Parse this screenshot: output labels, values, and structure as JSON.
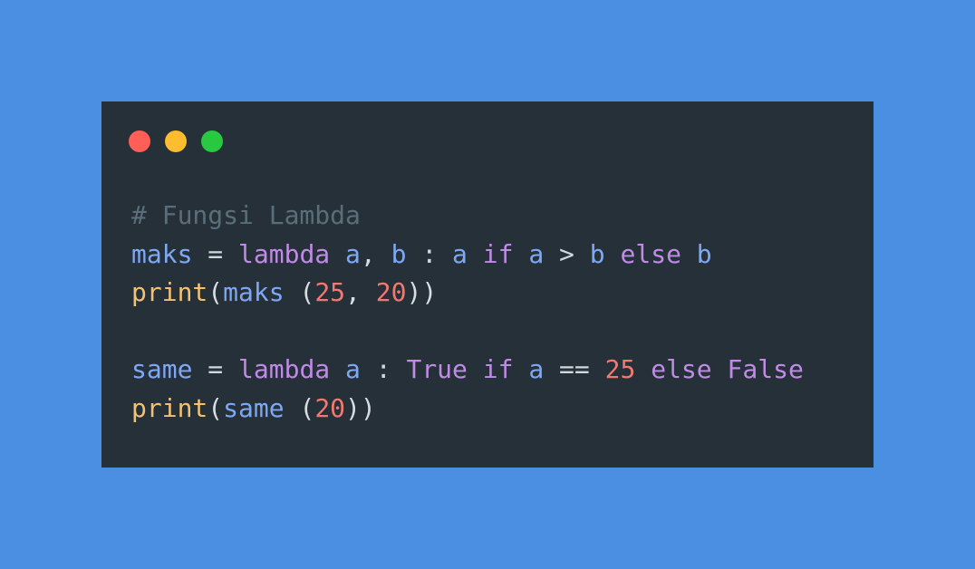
{
  "window": {
    "buttons": [
      {
        "name": "close-dot",
        "color": "#ff5f57"
      },
      {
        "name": "minimize-dot",
        "color": "#febc2e"
      },
      {
        "name": "maximize-dot",
        "color": "#28c840"
      }
    ]
  },
  "colors": {
    "background": "#4a8fe1",
    "editor": "#263038",
    "comment": "#5a6e7a",
    "variable": "#7fa8f4",
    "keyword": "#c08be6",
    "number": "#f07a70",
    "function": "#f2c172"
  },
  "code": {
    "lines": [
      {
        "tokens": [
          {
            "text": "# Fungsi Lambda",
            "type": "comment"
          }
        ]
      },
      {
        "tokens": [
          {
            "text": "maks",
            "type": "var"
          },
          {
            "text": " = ",
            "type": "op"
          },
          {
            "text": "lambda",
            "type": "kw"
          },
          {
            "text": " ",
            "type": "op"
          },
          {
            "text": "a",
            "type": "var"
          },
          {
            "text": ", ",
            "type": "punc"
          },
          {
            "text": "b",
            "type": "var"
          },
          {
            "text": " : ",
            "type": "op"
          },
          {
            "text": "a",
            "type": "var"
          },
          {
            "text": " ",
            "type": "op"
          },
          {
            "text": "if",
            "type": "kw"
          },
          {
            "text": " ",
            "type": "op"
          },
          {
            "text": "a",
            "type": "var"
          },
          {
            "text": " > ",
            "type": "op"
          },
          {
            "text": "b",
            "type": "var"
          },
          {
            "text": " ",
            "type": "op"
          },
          {
            "text": "else",
            "type": "kw"
          },
          {
            "text": " ",
            "type": "op"
          },
          {
            "text": "b",
            "type": "var"
          }
        ]
      },
      {
        "tokens": [
          {
            "text": "print",
            "type": "fn"
          },
          {
            "text": "(",
            "type": "punc"
          },
          {
            "text": "maks",
            "type": "var"
          },
          {
            "text": " (",
            "type": "punc"
          },
          {
            "text": "25",
            "type": "num"
          },
          {
            "text": ", ",
            "type": "punc"
          },
          {
            "text": "20",
            "type": "num"
          },
          {
            "text": "))",
            "type": "punc"
          }
        ]
      },
      {
        "tokens": [
          {
            "text": " ",
            "type": "op"
          }
        ]
      },
      {
        "tokens": [
          {
            "text": "same",
            "type": "var"
          },
          {
            "text": " = ",
            "type": "op"
          },
          {
            "text": "lambda",
            "type": "kw"
          },
          {
            "text": " ",
            "type": "op"
          },
          {
            "text": "a",
            "type": "var"
          },
          {
            "text": " : ",
            "type": "op"
          },
          {
            "text": "True",
            "type": "kw"
          },
          {
            "text": " ",
            "type": "op"
          },
          {
            "text": "if",
            "type": "kw"
          },
          {
            "text": " ",
            "type": "op"
          },
          {
            "text": "a",
            "type": "var"
          },
          {
            "text": " == ",
            "type": "op"
          },
          {
            "text": "25",
            "type": "num"
          },
          {
            "text": " ",
            "type": "op"
          },
          {
            "text": "else",
            "type": "kw"
          },
          {
            "text": " ",
            "type": "op"
          },
          {
            "text": "False",
            "type": "kw"
          }
        ]
      },
      {
        "tokens": [
          {
            "text": "print",
            "type": "fn"
          },
          {
            "text": "(",
            "type": "punc"
          },
          {
            "text": "same",
            "type": "var"
          },
          {
            "text": " (",
            "type": "punc"
          },
          {
            "text": "20",
            "type": "num"
          },
          {
            "text": "))",
            "type": "punc"
          }
        ]
      }
    ]
  }
}
